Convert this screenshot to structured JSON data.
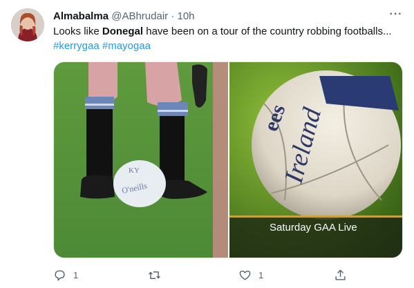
{
  "tweet": {
    "author_name": "Almabalma",
    "handle": "@ABhrudair",
    "separator": "·",
    "time": "10h",
    "text_before": "Looks like ",
    "text_bold": "Donegal",
    "text_after": " have been on a tour of the country robbing footballs...",
    "hashtag_1": "#kerrygaa",
    "hashtag_2": "#mayogaa"
  },
  "media": {
    "left_ball_text": "KY O'neills",
    "right_ball_brand": "O'Neills",
    "right_ball_text": "Ireland",
    "caption": "Saturday GAA Live"
  },
  "actions": {
    "reply_count": "1",
    "retweet_count": "",
    "like_count": "1"
  },
  "colors": {
    "link": "#1d9bf0",
    "text": "#0f1419",
    "secondary": "#536471"
  }
}
